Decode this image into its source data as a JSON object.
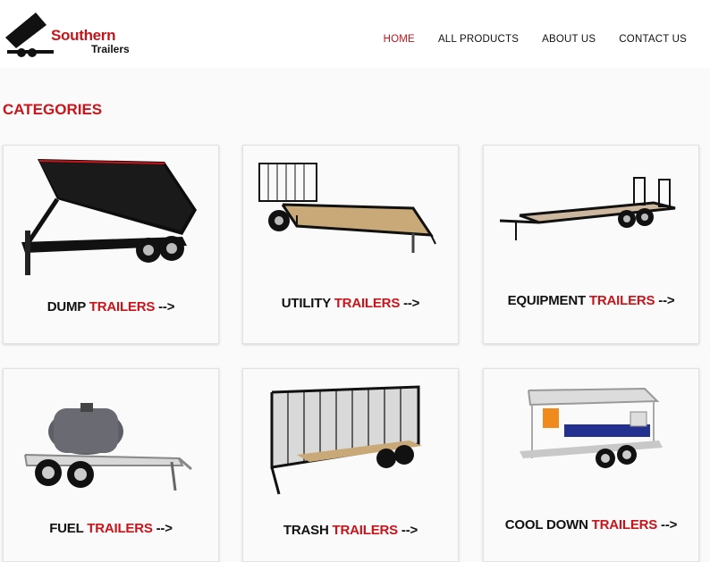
{
  "brand": {
    "line1": "Southern",
    "line2": "Trailers"
  },
  "nav": [
    {
      "label": "HOME",
      "active": true
    },
    {
      "label": "ALL PRODUCTS",
      "active": false
    },
    {
      "label": "ABOUT US",
      "active": false
    },
    {
      "label": "CONTACT US",
      "active": false
    }
  ],
  "section_title": "CATEGORIES",
  "cards": [
    {
      "name": "DUMP",
      "accent": "TRAILERS",
      "arrow": "-->",
      "icon": "dump-trailer-image"
    },
    {
      "name": "UTILITY",
      "accent": "TRAILERS",
      "arrow": "-->",
      "icon": "utility-trailer-image"
    },
    {
      "name": "EQUIPMENT",
      "accent": "TRAILERS",
      "arrow": "-->",
      "icon": "equipment-trailer-image"
    },
    {
      "name": "FUEL",
      "accent": "TRAILERS",
      "arrow": "-->",
      "icon": "fuel-trailer-image"
    },
    {
      "name": "TRASH",
      "accent": "TRAILERS",
      "arrow": "-->",
      "icon": "trash-trailer-image"
    },
    {
      "name": "COOL DOWN",
      "accent": "TRAILERS",
      "arrow": "-->",
      "icon": "cool-down-trailer-image"
    }
  ],
  "colors": {
    "accent": "#c8141a",
    "text": "#111111",
    "background": "#fafafa"
  }
}
